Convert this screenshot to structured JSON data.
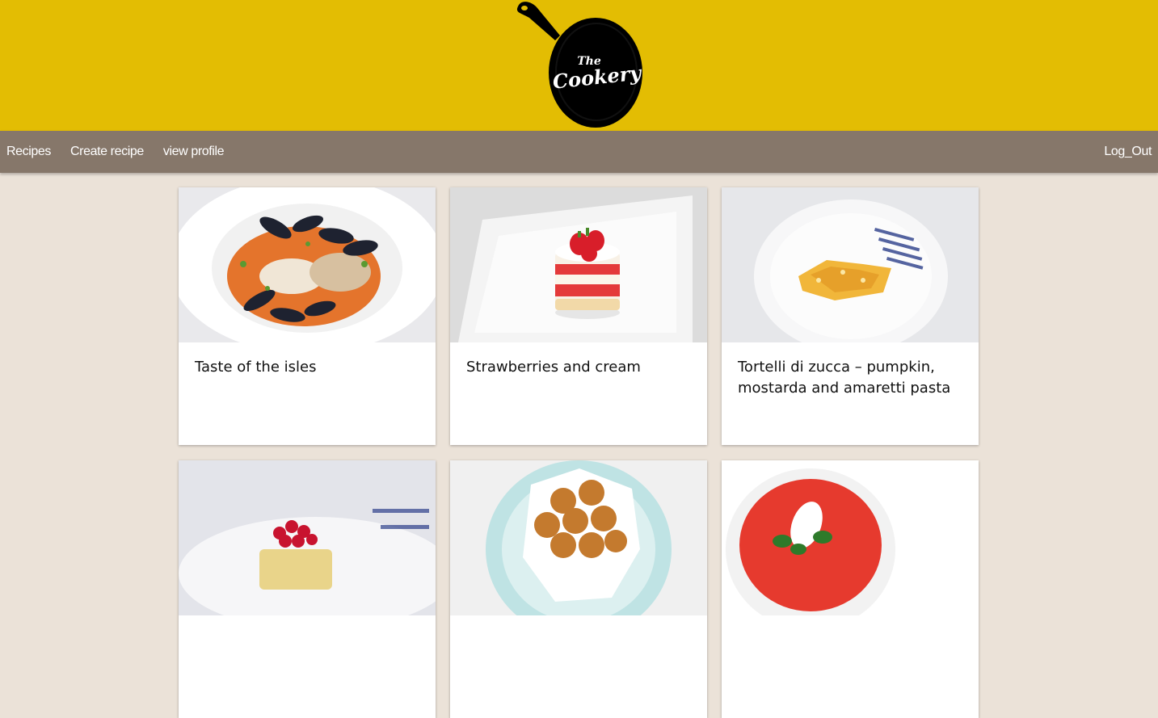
{
  "header": {
    "logo_text_top": "The",
    "logo_text_main": "Cookery",
    "brand_color": "#e3bd03"
  },
  "nav": {
    "items": [
      {
        "label": "Recipes"
      },
      {
        "label": "Create recipe"
      },
      {
        "label": "view profile"
      }
    ],
    "logout_label": "Log_Out",
    "background": "#86776a"
  },
  "recipes": [
    {
      "title": "Taste of the isles",
      "image": "mussels-fish-bowl"
    },
    {
      "title": "Strawberries and cream",
      "image": "strawberry-cake"
    },
    {
      "title": "Tortelli di zucca – pumpkin, mostarda and amaretti pasta",
      "image": "pumpkin-pasta-plate"
    },
    {
      "title": "",
      "image": "raspberry-tart"
    },
    {
      "title": "",
      "image": "sugar-doughnuts"
    },
    {
      "title": "",
      "image": "tomato-soup-mozzarella"
    }
  ]
}
